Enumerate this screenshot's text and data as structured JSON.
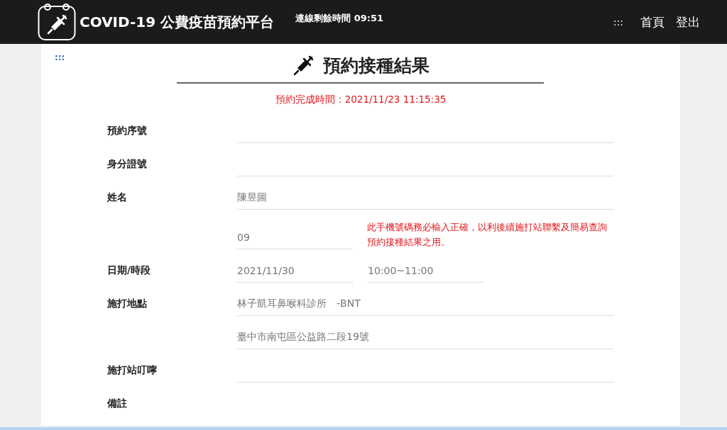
{
  "header": {
    "title": "COVID-19 公費疫苗預約平台",
    "session": "連線剩餘時間 09:51",
    "menu_glyph": ":::",
    "nav": [
      {
        "label": "首頁"
      },
      {
        "label": "登出"
      }
    ]
  },
  "page": {
    "toggle_glyph": ":::",
    "title": "預約接種結果",
    "completed": "預約完成時間：2021/11/23 11:15:35"
  },
  "rows": [
    {
      "kind": "single",
      "label": "預約序號"
    },
    {
      "kind": "single",
      "label": "身分證號"
    },
    {
      "kind": "single",
      "label": "姓名",
      "value": "陳昱圖"
    },
    {
      "kind": "note",
      "value": "09",
      "note": "此手機號碼務必輸入正確，以利後續施打站聯繫及簡易查詢預約接種結果之用。"
    },
    {
      "kind": "pair",
      "label": "日期/時段",
      "values": [
        "2021/11/30",
        "10:00~11:00"
      ]
    },
    {
      "kind": "single",
      "label": "施打地點",
      "value": "林子凱耳鼻喉科診所　-BNT"
    },
    {
      "kind": "single",
      "value": "臺中市南屯區公益路二段19號"
    },
    {
      "kind": "single",
      "label": "施打站叮嚀"
    },
    {
      "kind": "bare",
      "label": "備註"
    }
  ]
}
